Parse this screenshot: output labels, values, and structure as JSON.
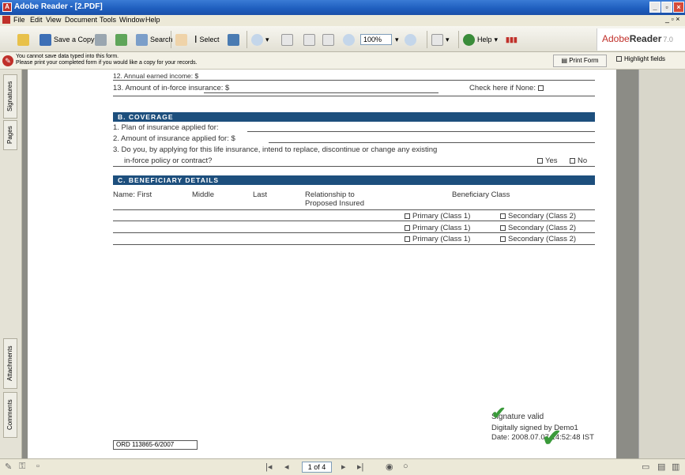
{
  "window": {
    "title": "Adobe Reader - [2.PDF]"
  },
  "menu": [
    "File",
    "Edit",
    "View",
    "Document",
    "Tools",
    "Window",
    "Help"
  ],
  "toolbar": {
    "save_copy": "Save a Copy",
    "search": "Search",
    "select": "Select",
    "zoom": "100%",
    "help": "Help",
    "brand_adobe": "Adobe",
    "brand_reader": "Reader",
    "brand_version": "7.0"
  },
  "notice": {
    "line1": "You cannot save data typed into this form.",
    "line2": "Please print your completed form if you would like a copy for your records.",
    "print_forms": "Print Form",
    "highlight_fields": "Highlight fields"
  },
  "left_tabs": [
    "Signatures",
    "Pages",
    "Attachments",
    "Comments"
  ],
  "form": {
    "line12": "12. Annual earned income: $",
    "line13": "13. Amount of in-force insurance: $",
    "check_none": "Check here if None:",
    "section_b": "B. COVERAGE",
    "b1": "1. Plan of insurance applied for:",
    "b2": "2. Amount of insurance applied for: $",
    "b3a": "3. Do you, by applying for this life insurance, intend to replace, discontinue or change any existing",
    "b3b": "in-force policy or contract?",
    "yes": "Yes",
    "no": "No",
    "section_c": "C. BENEFICIARY DETAILS",
    "col_name_first": "Name: First",
    "col_middle": "Middle",
    "col_last": "Last",
    "col_relationship_1": "Relationship to",
    "col_relationship_2": "Proposed Insured",
    "col_beneficiary_class": "Beneficiary Class",
    "rows": [
      {
        "primary": "Primary (Class 1)",
        "secondary": "Secondary (Class 2)"
      },
      {
        "primary": "Primary (Class 1)",
        "secondary": "Secondary (Class 2)"
      },
      {
        "primary": "Primary (Class 1)",
        "secondary": "Secondary (Class 2)"
      }
    ],
    "ord_code": "ORD 113865-6/2007"
  },
  "signature": {
    "status": "Signature valid",
    "signed_by": "Digitally signed by Demo1",
    "date": "Date: 2008.07.07 14:52:48 IST"
  },
  "status_bar": {
    "page_indicator": "1 of 4"
  },
  "colors": {
    "section_header": "#1d4f7d",
    "title_bar": "#1f5fbf",
    "check_green": "#3a9a3a"
  }
}
